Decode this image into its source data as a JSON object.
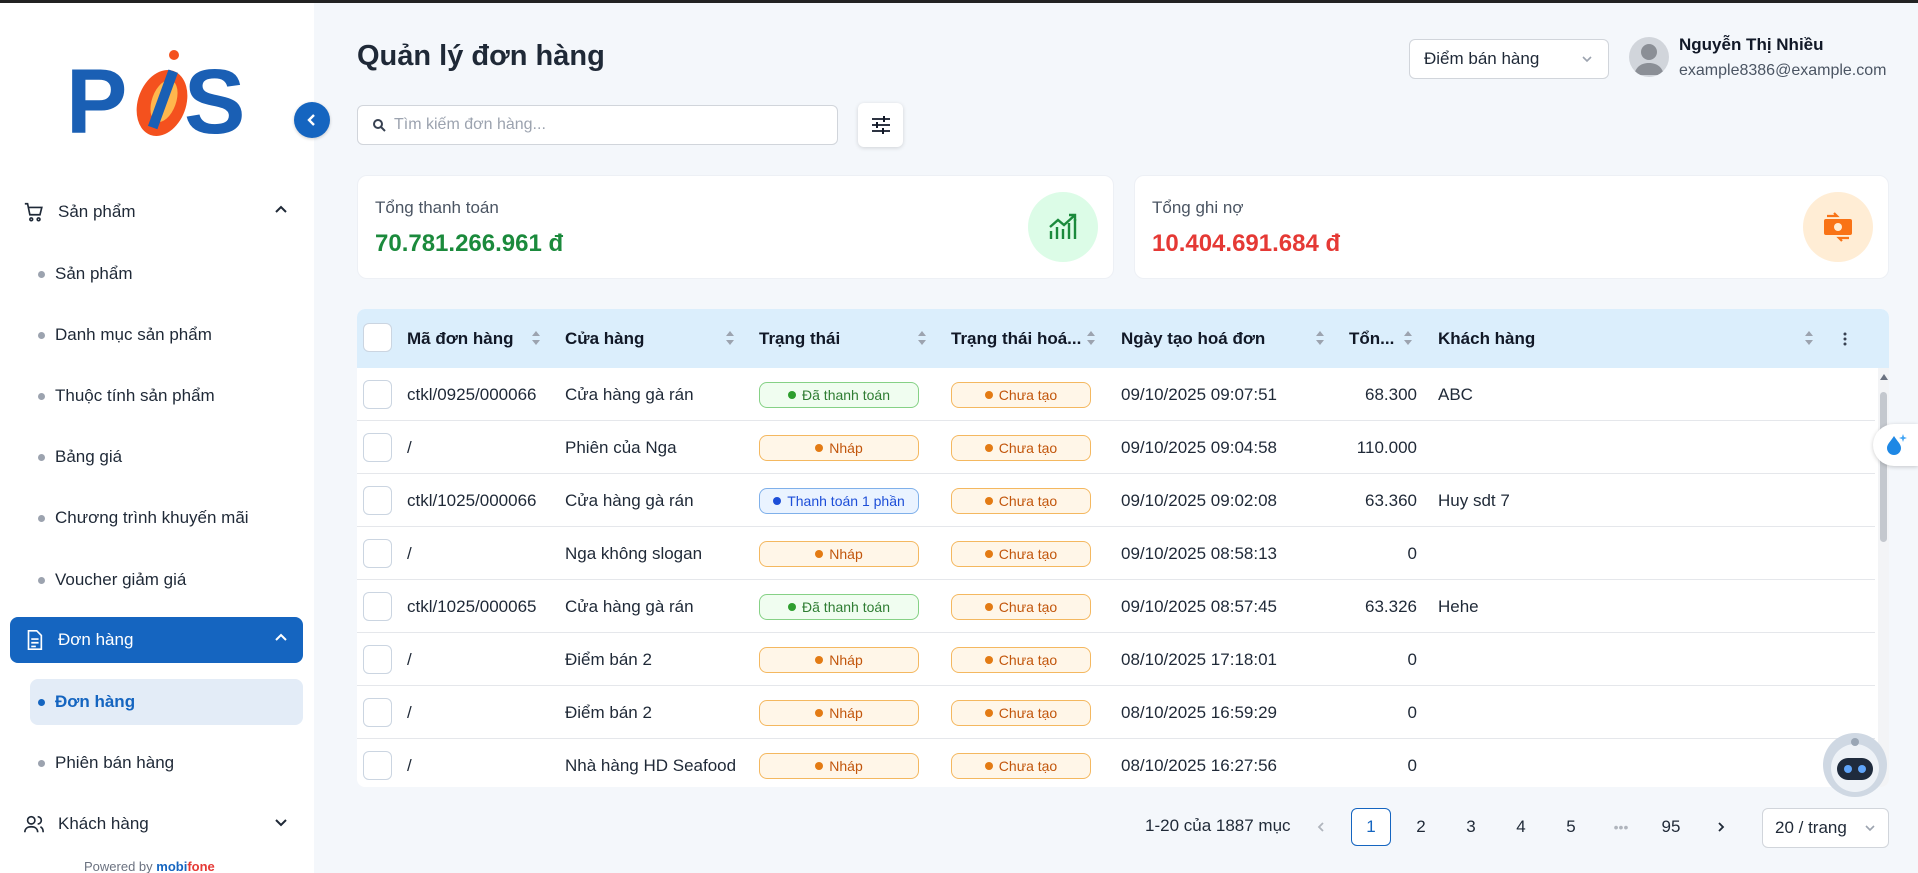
{
  "app": {
    "logo_text": "POS",
    "powered_by": "Powered by",
    "powered_brand_a": "mobi",
    "powered_brand_b": "fone"
  },
  "sidebar": {
    "groups": [
      {
        "label": "Sản phẩm",
        "icon": "cart-icon",
        "expanded": true
      },
      {
        "label": "Đơn hàng",
        "icon": "document-icon",
        "expanded": true,
        "active": true
      },
      {
        "label": "Khách hàng",
        "icon": "users-icon",
        "expanded": false
      }
    ],
    "product_items": [
      "Sản phẩm",
      "Danh mục sản phẩm",
      "Thuộc tính sản phẩm",
      "Bảng giá",
      "Chương trình khuyến mãi",
      "Voucher giảm giá"
    ],
    "order_items": [
      "Đơn hàng",
      "Phiên bán hàng"
    ]
  },
  "header": {
    "title": "Quản lý đơn hàng",
    "store_select": "Điểm bán hàng",
    "user_name": "Nguyễn Thị Nhiều",
    "user_email": "example8386@example.com"
  },
  "search": {
    "placeholder": "Tìm kiếm đơn hàng..."
  },
  "stats": {
    "total_paid_label": "Tổng thanh toán",
    "total_paid_value": "70.781.266.961 đ",
    "total_debt_label": "Tổng ghi nợ",
    "total_debt_value": "10.404.691.684 đ",
    "paid_color": "#1b8a3c",
    "debt_color": "#e53935"
  },
  "table": {
    "columns": [
      "Mã đơn hàng",
      "Cửa hàng",
      "Trạng thái",
      "Trạng thái hoá...",
      "Ngày tạo hoá đơn",
      "Tổn...",
      "Khách hàng"
    ],
    "rows": [
      {
        "code": "ctkl/0925/000066",
        "store": "Cửa hàng gà rán",
        "status": "Đã thanh toán",
        "status_type": "paid",
        "invoice_status": "Chưa tạo",
        "date": "09/10/2025 09:07:51",
        "total": "68.300",
        "customer": "ABC"
      },
      {
        "code": "/",
        "store": "Phiên của Nga",
        "status": "Nháp",
        "status_type": "draft",
        "invoice_status": "Chưa tạo",
        "date": "09/10/2025 09:04:58",
        "total": "110.000",
        "customer": ""
      },
      {
        "code": "ctkl/1025/000066",
        "store": "Cửa hàng gà rán",
        "status": "Thanh toán 1 phần",
        "status_type": "partial",
        "invoice_status": "Chưa tạo",
        "date": "09/10/2025 09:02:08",
        "total": "63.360",
        "customer": "Huy sdt 7"
      },
      {
        "code": "/",
        "store": "Nga không slogan",
        "status": "Nháp",
        "status_type": "draft",
        "invoice_status": "Chưa tạo",
        "date": "09/10/2025 08:58:13",
        "total": "0",
        "customer": ""
      },
      {
        "code": "ctkl/1025/000065",
        "store": "Cửa hàng gà rán",
        "status": "Đã thanh toán",
        "status_type": "paid",
        "invoice_status": "Chưa tạo",
        "date": "09/10/2025 08:57:45",
        "total": "63.326",
        "customer": "Hehe"
      },
      {
        "code": "/",
        "store": "Điểm bán 2",
        "status": "Nháp",
        "status_type": "draft",
        "invoice_status": "Chưa tạo",
        "date": "08/10/2025 17:18:01",
        "total": "0",
        "customer": ""
      },
      {
        "code": "/",
        "store": "Điểm bán 2",
        "status": "Nháp",
        "status_type": "draft",
        "invoice_status": "Chưa tạo",
        "date": "08/10/2025 16:59:29",
        "total": "0",
        "customer": ""
      },
      {
        "code": "/",
        "store": "Nhà hàng HD Seafood",
        "status": "Nháp",
        "status_type": "draft",
        "invoice_status": "Chưa tạo",
        "date": "08/10/2025 16:27:56",
        "total": "0",
        "customer": ""
      }
    ]
  },
  "pagination": {
    "info": "1-20 của 1887 mục",
    "pages": [
      "1",
      "2",
      "3",
      "4",
      "5"
    ],
    "ellipsis": "•••",
    "last_page": "95",
    "current": "1",
    "page_size": "20 / trang"
  }
}
